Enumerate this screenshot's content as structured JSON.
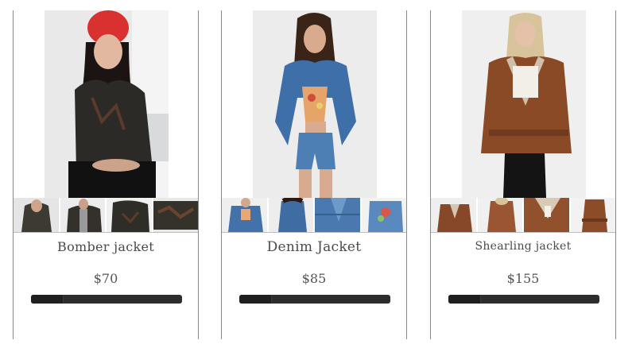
{
  "products": [
    {
      "name": "Bomber jacket",
      "price": "$70",
      "image": "woman-red-beanie-bomber-jacket",
      "thumb_count": 4
    },
    {
      "name": "Denim Jacket",
      "price": "$85",
      "image": "woman-denim-jacket-shorts",
      "thumb_count": 4
    },
    {
      "name": "Shearling jacket",
      "price": "$155",
      "image": "woman-brown-shearling-jacket",
      "thumb_count": 4
    }
  ],
  "colors": {
    "border": "#8a8a8a",
    "text": "#4a4a4a",
    "bar": "#2d2d2d"
  }
}
